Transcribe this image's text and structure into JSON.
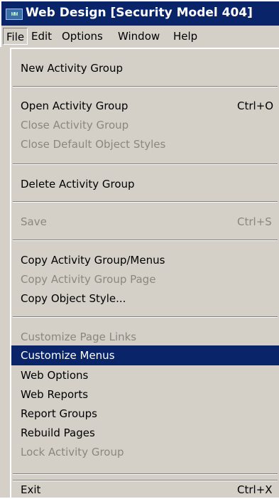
{
  "window": {
    "icon_text": "ᴍᴍ",
    "title": "Web Design [Security Model 404]"
  },
  "menubar": {
    "items": [
      {
        "label": "File"
      },
      {
        "label": "Edit"
      },
      {
        "label": "Options"
      },
      {
        "label": "Window"
      },
      {
        "label": "Help"
      }
    ]
  },
  "file_menu": {
    "new_activity_group": "New Activity Group",
    "open_activity_group": "Open Activity Group",
    "open_activity_group_shortcut": "Ctrl+O",
    "close_activity_group": "Close Activity Group",
    "close_default_object_styles": "Close Default Object Styles",
    "delete_activity_group": "Delete Activity Group",
    "save": "Save",
    "save_shortcut": "Ctrl+S",
    "copy_activity_group_menus": "Copy Activity Group/Menus",
    "copy_activity_group_page": "Copy Activity Group Page",
    "copy_object_style": "Copy Object Style...",
    "customize_page_links": "Customize Page Links",
    "customize_menus": "Customize Menus",
    "web_options": "Web Options",
    "web_reports": "Web Reports",
    "report_groups": "Report Groups",
    "rebuild_pages": "Rebuild Pages",
    "lock_activity_group": "Lock Activity Group",
    "exit": "Exit",
    "exit_shortcut": "Ctrl+X"
  },
  "colors": {
    "titlebar": "#0a246a",
    "selection": "#0a246a",
    "face": "#d4d0c8",
    "disabled_text": "#8a877f"
  }
}
